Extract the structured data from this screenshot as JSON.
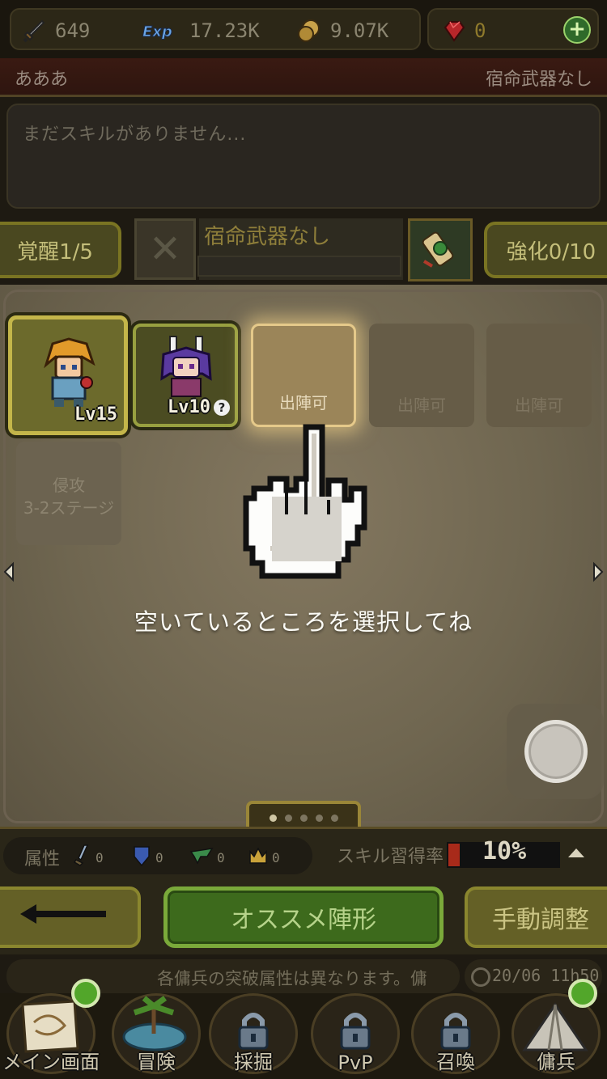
{
  "resources": {
    "attack": "649",
    "exp": "17.23K",
    "gold": "9.07K",
    "gems": "0",
    "exp_icon_text": "Exp"
  },
  "namebar": {
    "name": "あああ",
    "weapon_status": "宿命武器なし"
  },
  "skills": {
    "empty_text": "まだスキルがありません..."
  },
  "awaken": {
    "label": "覚醒1/5"
  },
  "weapon": {
    "name": "宿命武器なし"
  },
  "enhance": {
    "label": "強化0/10"
  },
  "party": {
    "hero1_level": "Lv15",
    "hero2_level": "Lv10",
    "help_badge": "?",
    "slot_label": "出陣可",
    "stage_line1": "侵攻",
    "stage_line2": "3-2ステージ"
  },
  "tutorial": {
    "hint": "空いているところを選択してね"
  },
  "stats": {
    "attribute_label": "属性",
    "sword_value": "0",
    "shield_value": "0",
    "wing_value": "0",
    "crown_value": "0",
    "skill_rate_label": "スキル習得率",
    "skill_rate_value": "10%",
    "skill_rate_fraction": 0.1
  },
  "actions": {
    "recommend": "オススメ陣形",
    "manual": "手動調整"
  },
  "ticker": {
    "text": "各傭兵の突破属性は異なります。傭",
    "clock": "20/06 11h50"
  },
  "nav": {
    "items": [
      {
        "label": "メイン画面"
      },
      {
        "label": "冒険"
      },
      {
        "label": "採掘"
      },
      {
        "label": "PvP"
      },
      {
        "label": "召喚"
      },
      {
        "label": "傭兵"
      }
    ]
  },
  "colors": {
    "accent_green": "#3d6a1c",
    "slot_highlight": "#e5c98a",
    "gold_text": "#8f7a2c"
  }
}
